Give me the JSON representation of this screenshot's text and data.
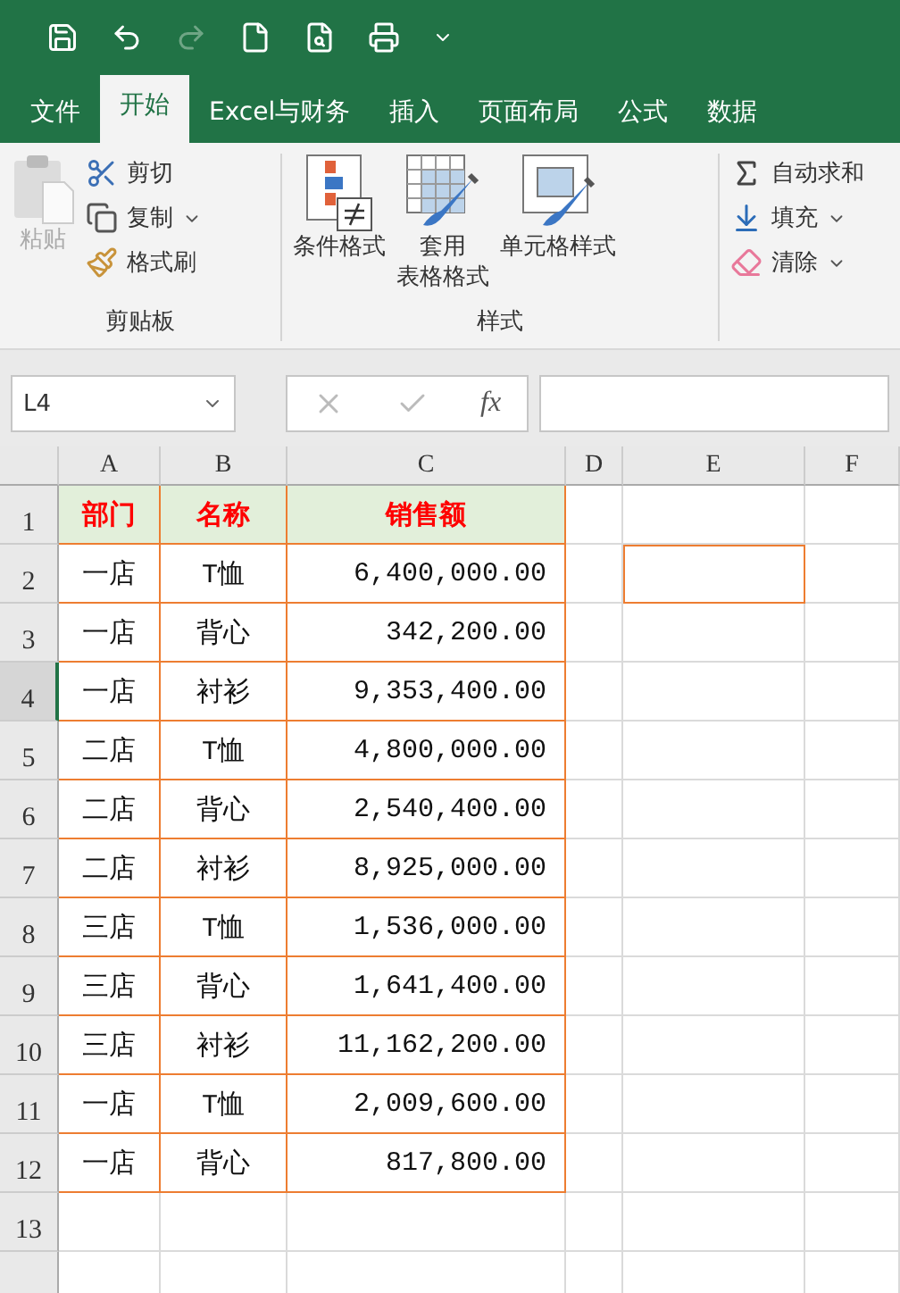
{
  "tabs": [
    {
      "label": "文件",
      "selected": false
    },
    {
      "label": "开始",
      "selected": true
    },
    {
      "label": "Excel与财务",
      "selected": false
    },
    {
      "label": "插入",
      "selected": false
    },
    {
      "label": "页面布局",
      "selected": false
    },
    {
      "label": "公式",
      "selected": false
    },
    {
      "label": "数据",
      "selected": false
    }
  ],
  "ribbon": {
    "clipboard": {
      "label": "剪贴板",
      "paste": {
        "label": "粘贴",
        "disabled": true
      },
      "small": [
        {
          "kind": "cut",
          "label": "剪切",
          "caret": false
        },
        {
          "kind": "copy",
          "label": "复制",
          "caret": true
        },
        {
          "kind": "brush",
          "label": "格式刷",
          "caret": false
        }
      ]
    },
    "styles": {
      "label": "样式",
      "buttons": [
        {
          "kind": "conditional",
          "lines": [
            "条件格式"
          ]
        },
        {
          "kind": "table",
          "lines": [
            "套用",
            "表格格式"
          ]
        },
        {
          "kind": "cell",
          "lines": [
            "单元格样式"
          ]
        }
      ]
    },
    "editing": {
      "small": [
        {
          "kind": "sum",
          "label": "自动求和",
          "caret": false
        },
        {
          "kind": "fill",
          "label": "填充",
          "caret": true
        },
        {
          "kind": "clear",
          "label": "清除",
          "caret": true
        }
      ]
    }
  },
  "name_box": {
    "value": "L4"
  },
  "formula_bar": {
    "fx_label": "fx"
  },
  "sheet": {
    "columns": [
      "A",
      "B",
      "C",
      "D",
      "E",
      "F"
    ],
    "rows": [
      {
        "header": "1",
        "selected": false,
        "kind": "title",
        "cells": [
          "部门",
          "名称",
          "销售额"
        ],
        "e_outlined": false
      },
      {
        "header": "2",
        "selected": false,
        "kind": "data",
        "cells": [
          "一店",
          "T恤",
          "6,400,000.00"
        ],
        "e_outlined": true
      },
      {
        "header": "3",
        "selected": false,
        "kind": "data",
        "cells": [
          "一店",
          "背心",
          "342,200.00"
        ],
        "e_outlined": false
      },
      {
        "header": "4",
        "selected": true,
        "kind": "data",
        "cells": [
          "一店",
          "衬衫",
          "9,353,400.00"
        ],
        "e_outlined": false
      },
      {
        "header": "5",
        "selected": false,
        "kind": "data",
        "cells": [
          "二店",
          "T恤",
          "4,800,000.00"
        ],
        "e_outlined": false
      },
      {
        "header": "6",
        "selected": false,
        "kind": "data",
        "cells": [
          "二店",
          "背心",
          "2,540,400.00"
        ],
        "e_outlined": false
      },
      {
        "header": "7",
        "selected": false,
        "kind": "data",
        "cells": [
          "二店",
          "衬衫",
          "8,925,000.00"
        ],
        "e_outlined": false
      },
      {
        "header": "8",
        "selected": false,
        "kind": "data",
        "cells": [
          "三店",
          "T恤",
          "1,536,000.00"
        ],
        "e_outlined": false
      },
      {
        "header": "9",
        "selected": false,
        "kind": "data",
        "cells": [
          "三店",
          "背心",
          "1,641,400.00"
        ],
        "e_outlined": false
      },
      {
        "header": "10",
        "selected": false,
        "kind": "data",
        "cells": [
          "三店",
          "衬衫",
          "11,162,200.00"
        ],
        "e_outlined": false
      },
      {
        "header": "11",
        "selected": false,
        "kind": "data",
        "cells": [
          "一店",
          "T恤",
          "2,009,600.00"
        ],
        "e_outlined": false
      },
      {
        "header": "12",
        "selected": false,
        "kind": "data",
        "cells": [
          "一店",
          "背心",
          "817,800.00"
        ],
        "e_outlined": false
      },
      {
        "header": "13",
        "selected": false,
        "kind": "empty",
        "cells": [],
        "e_outlined": false
      }
    ]
  }
}
